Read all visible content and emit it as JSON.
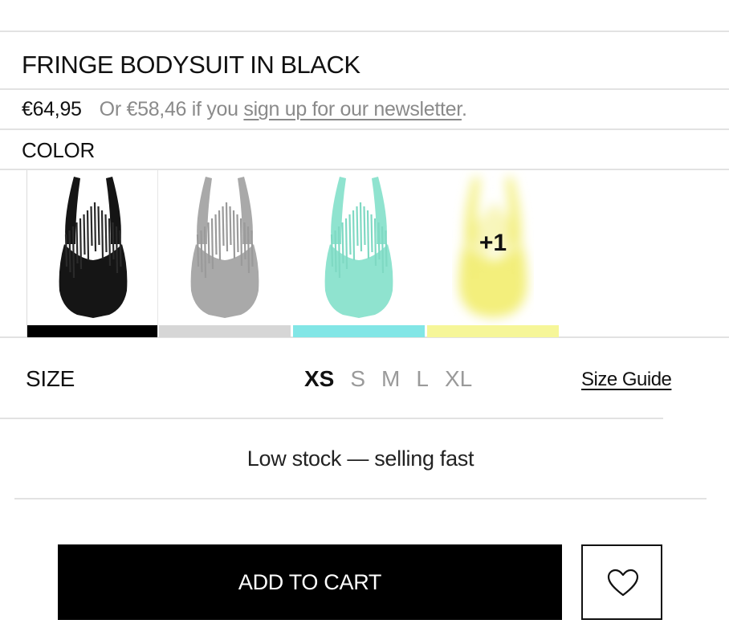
{
  "product": {
    "title": "FRINGE BODYSUIT IN BLACK",
    "price": "€64,95",
    "offer_prefix": "Or €58,46 if you ",
    "offer_link": "sign up for our newsletter",
    "offer_suffix": "."
  },
  "color": {
    "label": "COLOR",
    "swatches": [
      {
        "name": "black",
        "body_color": "#151515",
        "fringe_color": "#2a2a2a",
        "bar_color": "#000000"
      },
      {
        "name": "grey",
        "body_color": "#a9a9a9",
        "fringe_color": "#9a9a9a",
        "bar_color": "#d6d6d6"
      },
      {
        "name": "mint",
        "body_color": "#8fe3cf",
        "fringe_color": "#7fd9c3",
        "bar_color": "#82e6e6"
      },
      {
        "name": "yellow",
        "body_color": "#f3ef7c",
        "fringe_color": "#f1ec74",
        "bar_color": "#f6f699"
      }
    ],
    "more_count": "+1"
  },
  "size": {
    "label": "SIZE",
    "options": [
      "XS",
      "S",
      "M",
      "L",
      "XL"
    ],
    "selected": "XS",
    "guide_label": "Size Guide"
  },
  "stock_message": "Low stock — selling fast",
  "actions": {
    "add_to_cart_label": "ADD TO CART",
    "wishlist_icon": "heart-icon"
  }
}
